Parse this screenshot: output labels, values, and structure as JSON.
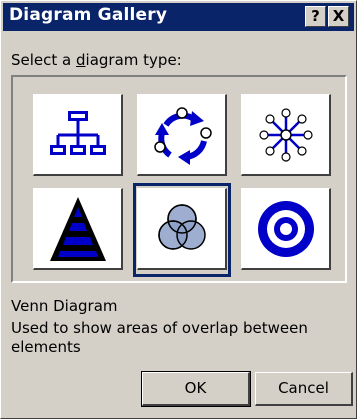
{
  "window": {
    "title": "Diagram Gallery",
    "help_label": "?",
    "close_label": "X"
  },
  "prompt": {
    "before": "Select a ",
    "mnemonic": "d",
    "after": "iagram type:"
  },
  "gallery": {
    "items": [
      {
        "name": "Organization Chart",
        "icon": "org-chart-icon"
      },
      {
        "name": "Cycle Diagram",
        "icon": "cycle-icon"
      },
      {
        "name": "Radial Diagram",
        "icon": "radial-icon"
      },
      {
        "name": "Pyramid Diagram",
        "icon": "pyramid-icon"
      },
      {
        "name": "Venn Diagram",
        "icon": "venn-icon"
      },
      {
        "name": "Target Diagram",
        "icon": "target-icon"
      }
    ],
    "selected_index": 4
  },
  "selected": {
    "name": "Venn Diagram",
    "description": "Used to show areas of overlap between elements"
  },
  "buttons": {
    "ok": "OK",
    "cancel": "Cancel"
  },
  "colors": {
    "titlebar": "#0a246a",
    "icon_blue": "#0000c8",
    "venn_fill": "#8ca0c8"
  }
}
